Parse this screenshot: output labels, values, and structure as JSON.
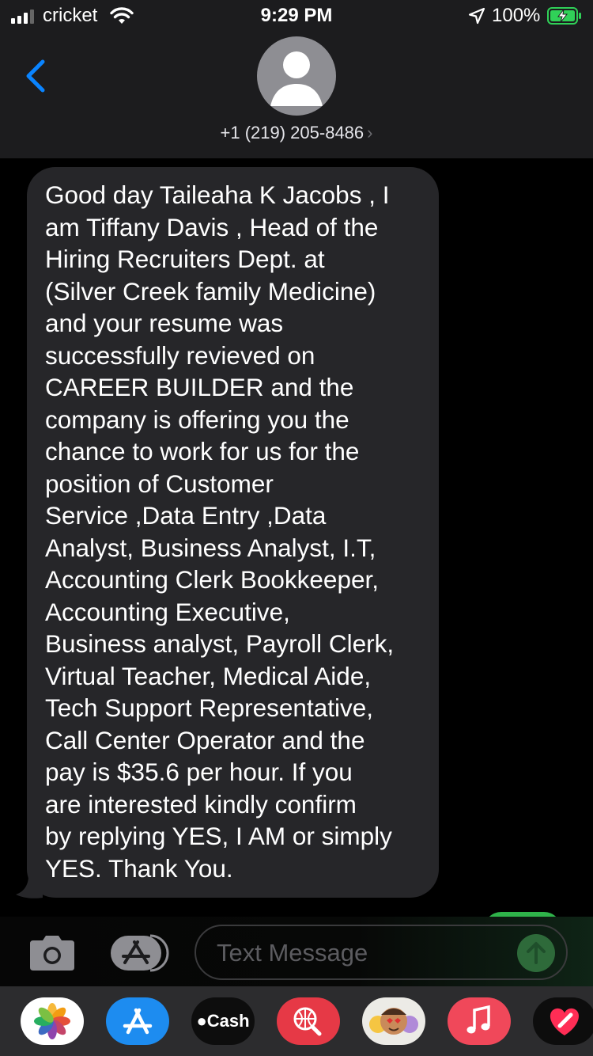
{
  "status_bar": {
    "carrier": "cricket",
    "time": "9:29 PM",
    "battery_percent": "100%",
    "signal_bars": 3,
    "icons": [
      "wifi-icon",
      "location-icon",
      "battery-charging-icon"
    ]
  },
  "header": {
    "back_icon": "chevron-left-icon",
    "contact_number": "+1 (219) 205-8486",
    "contact_chevron": "›",
    "avatar_icon": "person-icon"
  },
  "messages": [
    {
      "direction": "incoming",
      "text": "Good day Taileaha K Jacobs , I\nam Tiffany Davis , Head of the\nHiring Recruiters Dept. at\n(Silver Creek family Medicine)\nand your resume was\nsuccessfully revieved on\nCAREER BUILDER and the\ncompany is offering you the\nchance to work for us for the\nposition of Customer\nService ,Data Entry ,Data\nAnalyst, Business Analyst, I.T,\nAccounting Clerk Bookkeeper,\nAccounting Executive,\nBusiness analyst, Payroll Clerk,\nVirtual Teacher, Medical Aide,\nTech Support Representative,\nCall Center Operator and the\npay is $35.6 per hour. If you\nare interested kindly confirm\nby replying YES, I AM or simply\nYES. Thank You."
    }
  ],
  "compose": {
    "placeholder": "Text Message",
    "value": "",
    "camera_icon": "camera-icon",
    "apps_icon": "app-store-icon",
    "send_icon": "arrow-up-icon"
  },
  "app_drawer": {
    "apps": [
      {
        "name": "photos",
        "icon": "photos-icon"
      },
      {
        "name": "app-store",
        "icon": "app-store-icon"
      },
      {
        "name": "cash",
        "label": "Cash",
        "icon": "apple-logo-icon"
      },
      {
        "name": "web-search",
        "icon": "globe-search-icon"
      },
      {
        "name": "memoji",
        "icon": "memoji-icon"
      },
      {
        "name": "music",
        "icon": "music-note-icon"
      },
      {
        "name": "digital-touch",
        "icon": "heart-icon"
      }
    ]
  },
  "colors": {
    "header_bg": "#1c1c1e",
    "incoming_bubble": "#262629",
    "ios_blue": "#0a84ff",
    "ios_green": "#30d158",
    "drawer_bg": "#2c2c2e"
  }
}
